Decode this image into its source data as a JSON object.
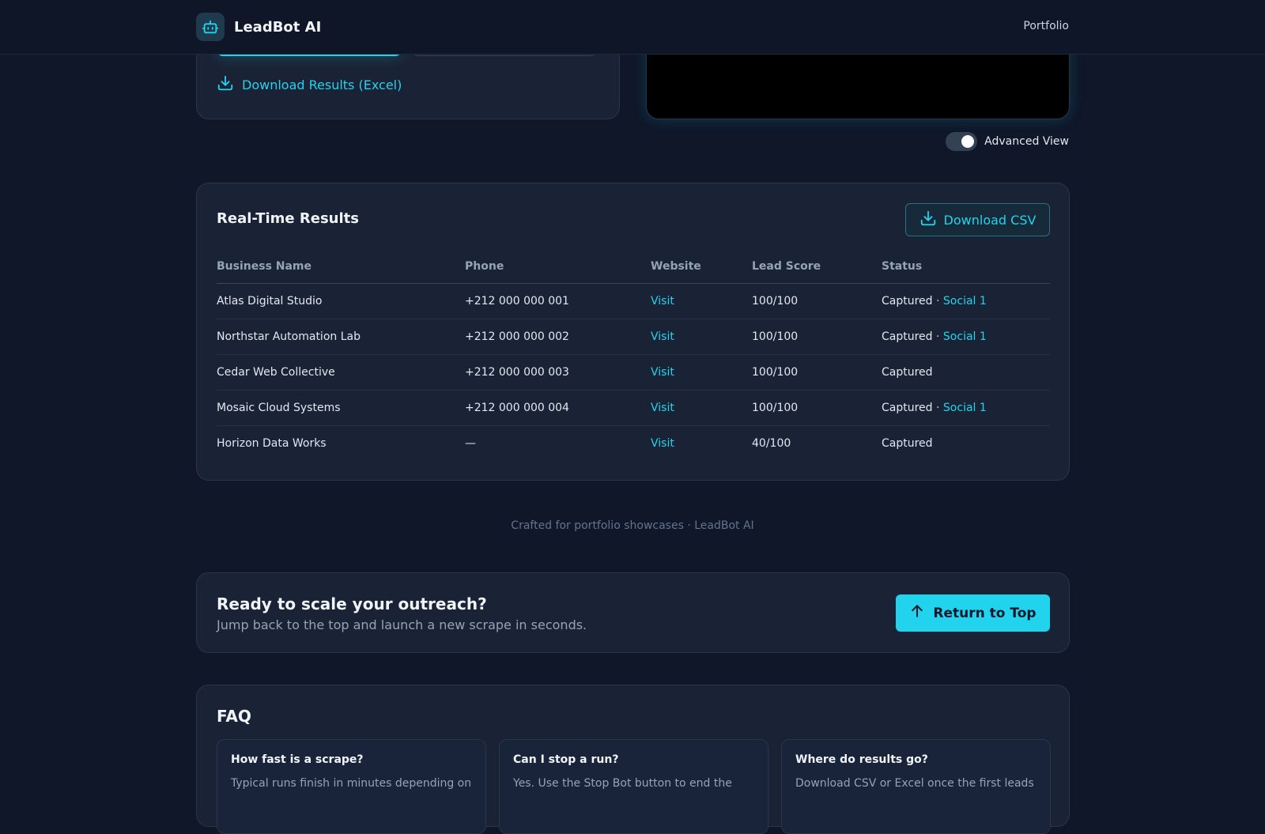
{
  "header": {
    "brand": "LeadBot AI",
    "nav": "Portfolio"
  },
  "controls": {
    "download_excel": "Download Results (Excel)",
    "advanced_view_label": "Advanced View",
    "advanced_view_on": true
  },
  "results": {
    "title": "Real-Time Results",
    "download_csv": "Download CSV",
    "columns": [
      "Business Name",
      "Phone",
      "Website",
      "Lead Score",
      "Status"
    ],
    "rows": [
      {
        "name": "Atlas Digital Studio",
        "phone": "+212 000 000 001",
        "website": "Visit",
        "score": "100/100",
        "status": "Captured",
        "social": "Social 1"
      },
      {
        "name": "Northstar Automation Lab",
        "phone": "+212 000 000 002",
        "website": "Visit",
        "score": "100/100",
        "status": "Captured",
        "social": "Social 1"
      },
      {
        "name": "Cedar Web Collective",
        "phone": "+212 000 000 003",
        "website": "Visit",
        "score": "100/100",
        "status": "Captured",
        "social": ""
      },
      {
        "name": "Mosaic Cloud Systems",
        "phone": "+212 000 000 004",
        "website": "Visit",
        "score": "100/100",
        "status": "Captured",
        "social": "Social 1"
      },
      {
        "name": "Horizon Data Works",
        "phone": "—",
        "website": "Visit",
        "score": "40/100",
        "status": "Captured",
        "social": ""
      }
    ]
  },
  "footer_note": "Crafted for portfolio showcases · LeadBot AI",
  "cta": {
    "title": "Ready to scale your outreach?",
    "subtitle": "Jump back to the top and launch a new scrape in seconds.",
    "button": "Return to Top"
  },
  "faq": {
    "title": "FAQ",
    "items": [
      {
        "q": "How fast is a scrape?",
        "a": "Typical runs finish in minutes depending on"
      },
      {
        "q": "Can I stop a run?",
        "a": "Yes. Use the Stop Bot button to end the"
      },
      {
        "q": "Where do results go?",
        "a": "Download CSV or Excel once the first leads"
      }
    ]
  },
  "colors": {
    "accent": "#22d3ee",
    "background": "#0f1729",
    "card": "#1a2335"
  }
}
